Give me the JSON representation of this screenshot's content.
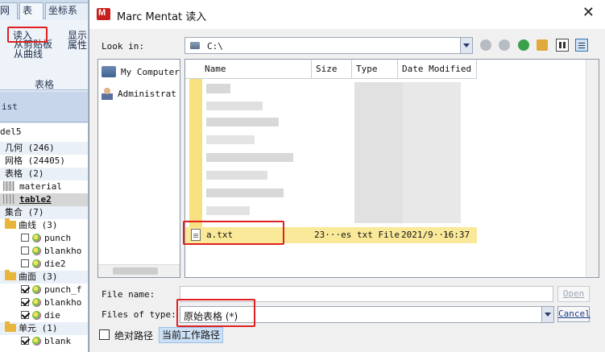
{
  "background_app": {
    "tabs": [
      "网",
      "表格",
      "坐标系"
    ],
    "ribbon": {
      "read_label": "读入",
      "from_clipboard": "从剪贴板",
      "from_curve": "从曲线",
      "show_label": "显示",
      "prop_label": "属性",
      "group_label": "表格"
    },
    "list_label": "ist",
    "model_label": "del5",
    "tree": [
      {
        "text": "几何 (246)"
      },
      {
        "text": "网格 (24405)"
      },
      {
        "text": "表格 (2)"
      },
      {
        "text": "material"
      },
      {
        "text": "table2"
      },
      {
        "text": "集合 (7)"
      },
      {
        "text": "曲线 (3)"
      },
      {
        "text": "punch"
      },
      {
        "text": "blankho"
      },
      {
        "text": "die2"
      },
      {
        "text": "曲面 (3)"
      },
      {
        "text": "punch_f"
      },
      {
        "text": "blankho"
      },
      {
        "text": "die"
      },
      {
        "text": "单元 (1)"
      },
      {
        "text": "blank"
      }
    ]
  },
  "dialog": {
    "title": "Marc Mentat 读入",
    "close_glyph": "✕",
    "look_in_label": "Look in:",
    "look_in_value": "C:\\",
    "sidebar": [
      "My Computer",
      "Administrat"
    ],
    "columns": {
      "name": "Name",
      "size": "Size",
      "type": "Type",
      "date": "Date Modified"
    },
    "selected_file": {
      "name": "a.txt",
      "size": "23···es",
      "type": "txt File",
      "date": "2021/9···",
      "time": "16:37"
    },
    "file_name_label": "File name:",
    "file_name_value": "",
    "files_of_type_label": "Files of type:",
    "files_of_type_value": "原始表格 (*)",
    "open_button": "Open",
    "cancel_button": "Cancel",
    "absolute_path_label": "绝对路径",
    "current_dir_button": "当前工作路径"
  }
}
